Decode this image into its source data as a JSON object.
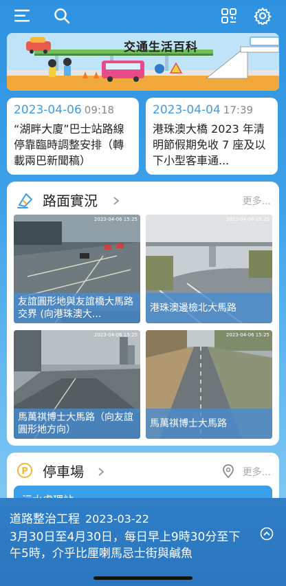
{
  "banner": {
    "title": "交通生活百科"
  },
  "news": [
    {
      "date": "2023-04-06",
      "time": "09:18",
      "text": "“湖畔大廈”巴士站路線停靠臨時調整安排（轉載兩巴新聞稿）"
    },
    {
      "date": "2023-04-04",
      "time": "17:39",
      "text": "港珠澳大橋 2023 年清明節假期免收 7 座及以下小型客車通..."
    }
  ],
  "road_section": {
    "title": "路面實況",
    "more": "更多...",
    "cameras": [
      {
        "caption": "友誼圓形地與友誼橋大馬路交界 (向港珠澳大...",
        "stamp": "2023-04-06 15:25"
      },
      {
        "caption": "港珠澳邊檢北大馬路",
        "stamp": "2023-04-06 15:25"
      },
      {
        "caption": "馬萬祺博士大馬路（向友誼圓形地方向）",
        "stamp": "2023-04-06 15:25"
      },
      {
        "caption": "馬萬祺博士大馬路",
        "stamp": "2023-04-06 15:25"
      }
    ]
  },
  "parking_section": {
    "title": "停車場",
    "more": "更多...",
    "partial_item": "污水處理站"
  },
  "alert": {
    "title": "道路整治工程",
    "date": "2023-03-22",
    "body": "3月30日至4月30日，每日早上9時30分至下午5時，介乎比厘喇馬忌士街與鹹魚"
  },
  "colors": {
    "accent": "#3a9ee8",
    "alert_bg": "#2f7ec7"
  }
}
